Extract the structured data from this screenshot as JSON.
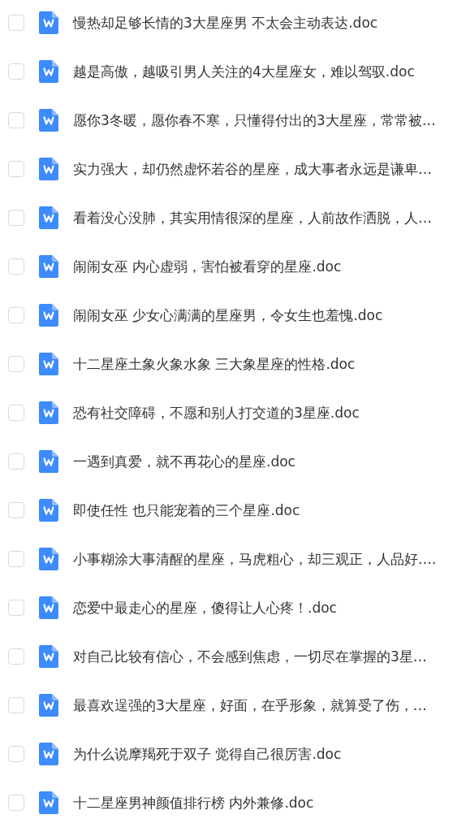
{
  "files": [
    {
      "name": "慢热却足够长情的3大星座男 不太会主动表达.doc",
      "checked": false
    },
    {
      "name": "越是高傲，越吸引男人关注的4大星座女，难以驾驭.doc",
      "checked": false
    },
    {
      "name": "愿你3冬暖，愿你春不寒，只懂得付出的3大星座，常常被…",
      "checked": false
    },
    {
      "name": "实力强大，却仍然虚怀若谷的星座，成大事者永远是谦卑…",
      "checked": false
    },
    {
      "name": "看着没心没肺，其实用情很深的星座，人前故作洒脱，人…",
      "checked": false
    },
    {
      "name": "闹闹女巫  内心虚弱，害怕被看穿的星座.doc",
      "checked": false
    },
    {
      "name": "闹闹女巫 少女心满满的星座男，令女生也羞愧.doc",
      "checked": false
    },
    {
      "name": "十二星座土象火象水象 三大象星座的性格.doc",
      "checked": false
    },
    {
      "name": "恐有社交障碍，不愿和别人打交道的3星座.doc",
      "checked": false
    },
    {
      "name": "一遇到真爱，就不再花心的星座.doc",
      "checked": false
    },
    {
      "name": "即使任性 也只能宠着的三个星座.doc",
      "checked": false
    },
    {
      "name": "小事糊涂大事清醒的星座，马虎粗心，却三观正，人品好.…",
      "checked": false
    },
    {
      "name": "恋爱中最走心的星座，傻得让人心疼！.doc",
      "checked": false
    },
    {
      "name": "对自己比较有信心，不会感到焦虑，一切尽在掌握的3星…",
      "checked": false
    },
    {
      "name": "最喜欢逞强的3大星座，好面，在乎形象，就算受了伤，…",
      "checked": false
    },
    {
      "name": "为什么说摩羯死于双子 觉得自己很厉害.doc",
      "checked": false
    },
    {
      "name": "十二星座男神颜值排行榜 内外兼修.doc",
      "checked": false
    }
  ]
}
